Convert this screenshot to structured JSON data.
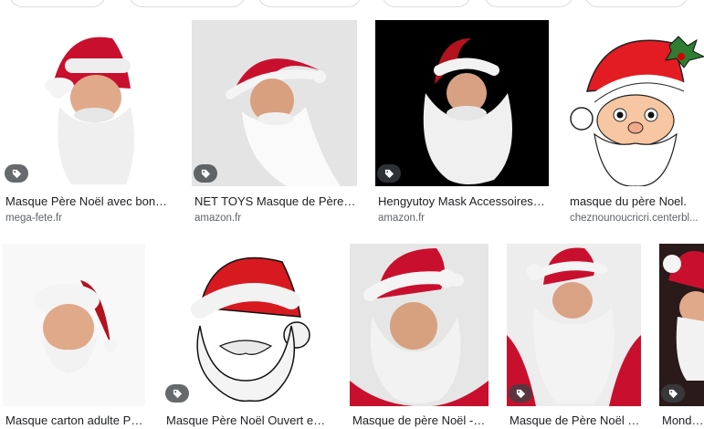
{
  "colors": {
    "hat_red": "#c8102e",
    "fur_white": "#f4f4f4",
    "skin": "#e8b89a",
    "title_text": "#202124",
    "source_text": "#5f6368",
    "tag_bg": "#3c4043"
  },
  "icons": {
    "product_tag": "tag-icon"
  },
  "results": [
    {
      "title": "Masque Père Noël avec bonnet ...",
      "source": "mega-fete.fr"
    },
    {
      "title": "NET TOYS Masque de Père N...",
      "source": "amazon.fr"
    },
    {
      "title": "Hengyutoy Mask Accessoires d...",
      "source": "amazon.fr"
    },
    {
      "title": "masque du père Noel.",
      "source": "cheznounoucricri.centerbl..."
    },
    {
      "title": "Masque carton adulte Pè...",
      "source": ""
    },
    {
      "title": "Masque Père Noël Ouvert en ...",
      "source": ""
    },
    {
      "title": "Masque de père Noël - C...",
      "source": ""
    },
    {
      "title": "Masque de Père Noël p...",
      "source": ""
    },
    {
      "title": "Mondial-...",
      "source": ""
    }
  ]
}
